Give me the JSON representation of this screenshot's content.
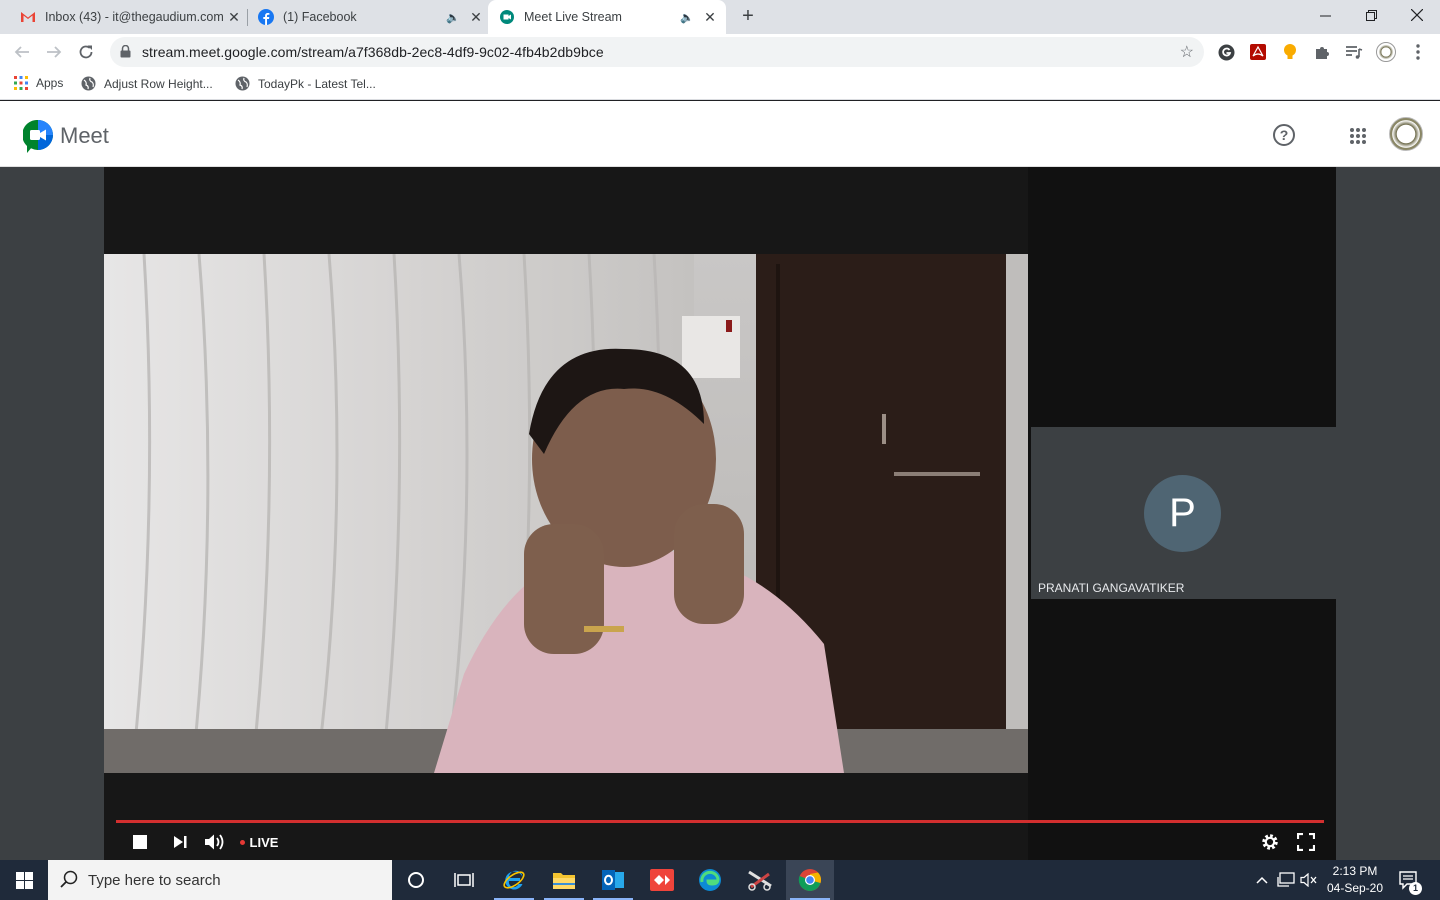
{
  "browser": {
    "tabs": [
      {
        "title": "Inbox (43) - it@thegaudium.com",
        "favicon": "gmail-icon"
      },
      {
        "title": "(1) Facebook",
        "favicon": "facebook-icon"
      },
      {
        "title": "Meet Live Stream",
        "favicon": "meet-icon",
        "active": true
      }
    ],
    "url": "stream.meet.google.com/stream/a7f368db-2ec8-4df9-9c02-4fb4b2db9bce",
    "bookmarks": [
      {
        "label": "Apps",
        "icon": "apps-grid-icon"
      },
      {
        "label": "Adjust Row Height...",
        "icon": "globe-icon"
      },
      {
        "label": "TodayPk - Latest Tel...",
        "icon": "globe-icon"
      }
    ]
  },
  "meet": {
    "brand": "Meet",
    "participant": {
      "initial": "P",
      "name": "PRANATI GANGAVATIKER"
    },
    "player": {
      "live_label": "LIVE",
      "progress": 1.0
    }
  },
  "taskbar": {
    "search_placeholder": "Type here to search",
    "time": "2:13 PM",
    "date": "04-Sep-20",
    "notification_count": "1"
  },
  "colors": {
    "accent_live": "#d32f2f",
    "meet_green": "#00832d"
  }
}
